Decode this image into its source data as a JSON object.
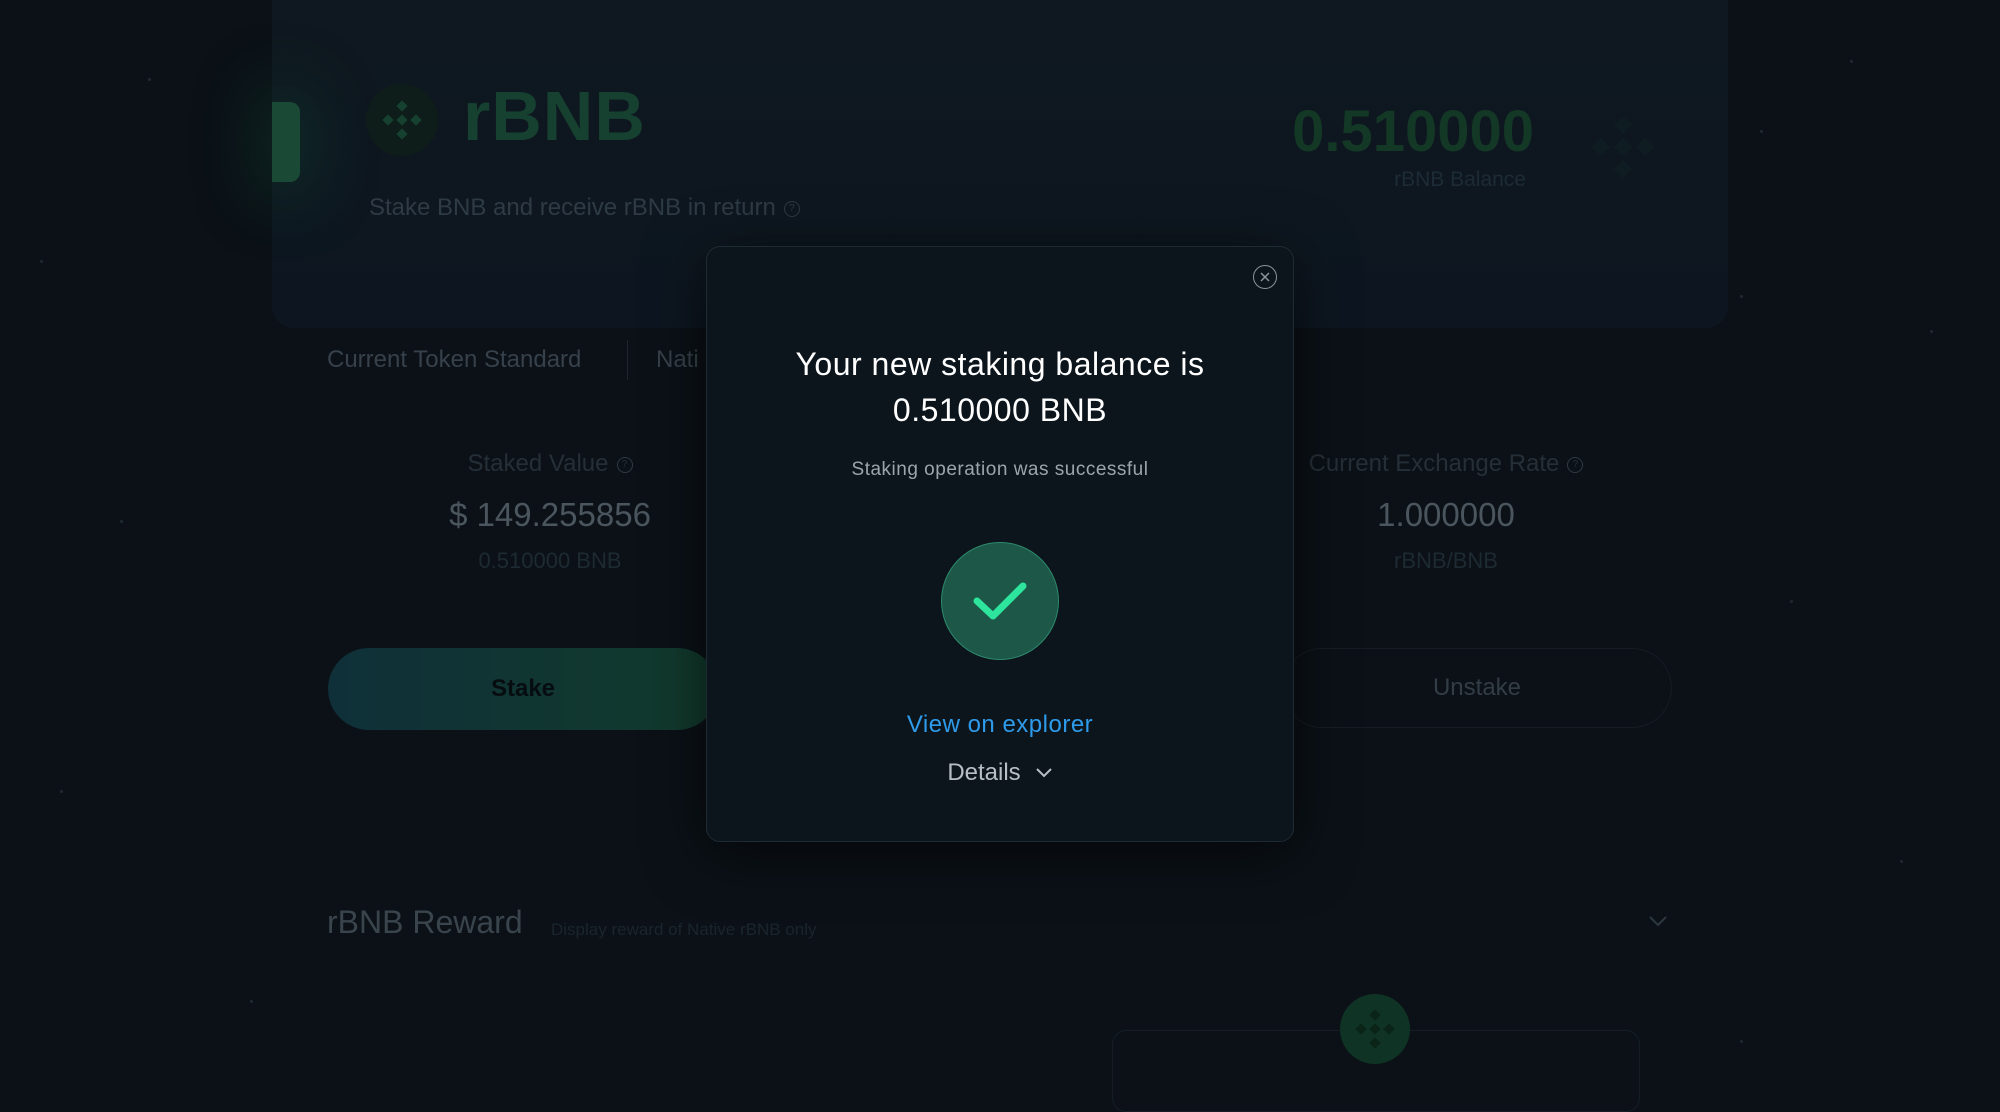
{
  "hero": {
    "title": "rBNB",
    "subtitle": "Stake BNB and receive rBNB in return",
    "balance_value": "0.510000",
    "balance_label": "rBNB Balance"
  },
  "token_standard": {
    "label": "Current Token Standard",
    "value": "Nati"
  },
  "stats": {
    "staked_label": "Staked Value",
    "staked_value": "$ 149.255856",
    "staked_sub": "0.510000 BNB",
    "rate_label": "Current Exchange Rate",
    "rate_value": "1.000000",
    "rate_sub": "rBNB/BNB"
  },
  "actions": {
    "stake_label": "Stake",
    "unstake_label": "Unstake"
  },
  "reward": {
    "title": "rBNB Reward",
    "subtitle": "Display reward of Native rBNB only"
  },
  "modal": {
    "title_line1": "Your new staking balance is",
    "title_line2": "0.510000 BNB",
    "subtitle": "Staking operation was successful",
    "explorer_link": "View on explorer",
    "details_label": "Details"
  },
  "colors": {
    "background": "#0b1117",
    "modal_bg": "#0c151c",
    "success_green": "#2ee59d",
    "link_blue": "#2e9bea"
  },
  "icons": [
    "bnb-logo-icon",
    "help-icon",
    "close-icon",
    "checkmark-icon",
    "chevron-down-icon"
  ]
}
